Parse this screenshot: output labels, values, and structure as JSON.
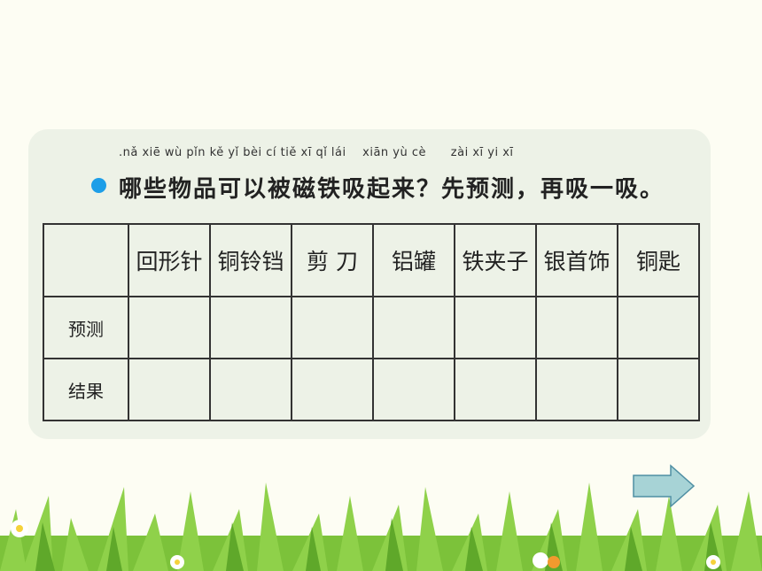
{
  "pinyin": ".nǎ xiē wù pǐn kě yǐ bèi cí tiě xī qǐ lái    xiān yù cè      zài xī yi xī",
  "question": "哪些物品可以被磁铁吸起来？先预测，再吸一吸。",
  "table": {
    "corner": "",
    "columns": [
      "回形针",
      "铜铃铛",
      "剪 刀",
      "铝罐",
      "铁夹子",
      "银首饰",
      "铜匙"
    ],
    "rows": [
      {
        "label": "预测",
        "cells": [
          "",
          "",
          "",
          "",
          "",
          "",
          ""
        ]
      },
      {
        "label": "结果",
        "cells": [
          "",
          "",
          "",
          "",
          "",
          "",
          ""
        ]
      }
    ]
  },
  "colors": {
    "bullet": "#1d9ee8",
    "card": "#edf2e7",
    "arrow": "#a7d3d6"
  },
  "icons": {
    "next": "right-arrow-icon",
    "bullet": "bullet-dot-icon"
  }
}
